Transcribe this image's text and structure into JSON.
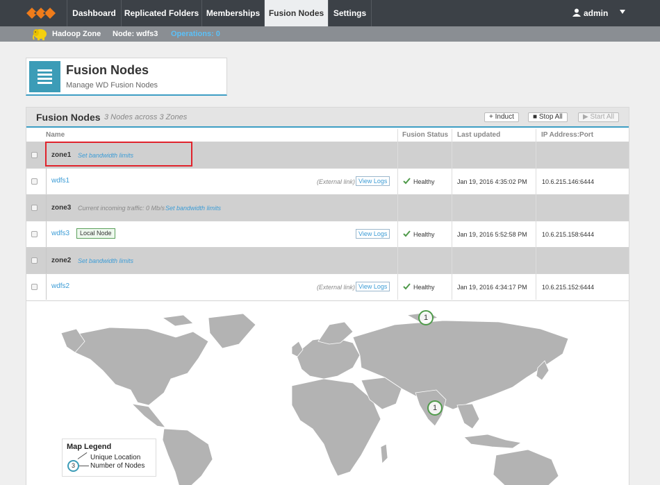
{
  "topnav": {
    "tabs": [
      {
        "label": "Dashboard"
      },
      {
        "label": "Replicated Folders"
      },
      {
        "label": "Memberships"
      },
      {
        "label": "Fusion Nodes"
      },
      {
        "label": "Settings"
      }
    ],
    "active_tab": "Fusion Nodes",
    "user": "admin"
  },
  "subbar": {
    "zone": "Hadoop Zone",
    "node": "Node: wdfs3",
    "operations": "Operations: 0"
  },
  "header": {
    "title": "Fusion Nodes",
    "subtitle": "Manage WD Fusion Nodes"
  },
  "panel": {
    "title": "Fusion Nodes",
    "summary": "3 Nodes across 3 Zones",
    "buttons": {
      "induct": "+ Induct",
      "stop_all": "■ Stop All",
      "start_all": "▶ Start All"
    },
    "columns": {
      "name": "Name",
      "status": "Fusion Status",
      "updated": "Last updated",
      "ip": "IP Address:Port"
    },
    "rows": [
      {
        "type": "zone",
        "name": "zone1",
        "traffic": "",
        "link": "Set bandwidth limits"
      },
      {
        "type": "node",
        "name": "wdfs1",
        "badge": "",
        "external": "(External link)",
        "logs": "View Logs",
        "status": "Healthy",
        "updated": "Jan 19, 2016 4:35:02 PM",
        "ip": "10.6.215.146:6444"
      },
      {
        "type": "zone",
        "name": "zone3",
        "traffic": "Current incoming traffic: 0 Mb/s",
        "link": "Set bandwidth limits"
      },
      {
        "type": "node",
        "name": "wdfs3",
        "badge": "Local Node",
        "external": "",
        "logs": "View Logs",
        "status": "Healthy",
        "updated": "Jan 19, 2016 5:52:58 PM",
        "ip": "10.6.215.158:6444"
      },
      {
        "type": "zone",
        "name": "zone2",
        "traffic": "",
        "link": "Set bandwidth limits"
      },
      {
        "type": "node",
        "name": "wdfs2",
        "badge": "",
        "external": "(External link)",
        "logs": "View Logs",
        "status": "Healthy",
        "updated": "Jan 19, 2016 4:34:17 PM",
        "ip": "10.6.215.152:6444"
      }
    ]
  },
  "map": {
    "markers": [
      {
        "count": "1"
      },
      {
        "count": "1"
      }
    ],
    "legend": {
      "title": "Map Legend",
      "example": "3",
      "line1": "Unique Location",
      "line2": "Number of Nodes"
    }
  },
  "colors": {
    "nav_bg": "#3c4147",
    "accent": "#3c9cb7",
    "link": "#3c9cd6",
    "healthy": "#4f9a4a",
    "highlight": "#e0222b"
  }
}
